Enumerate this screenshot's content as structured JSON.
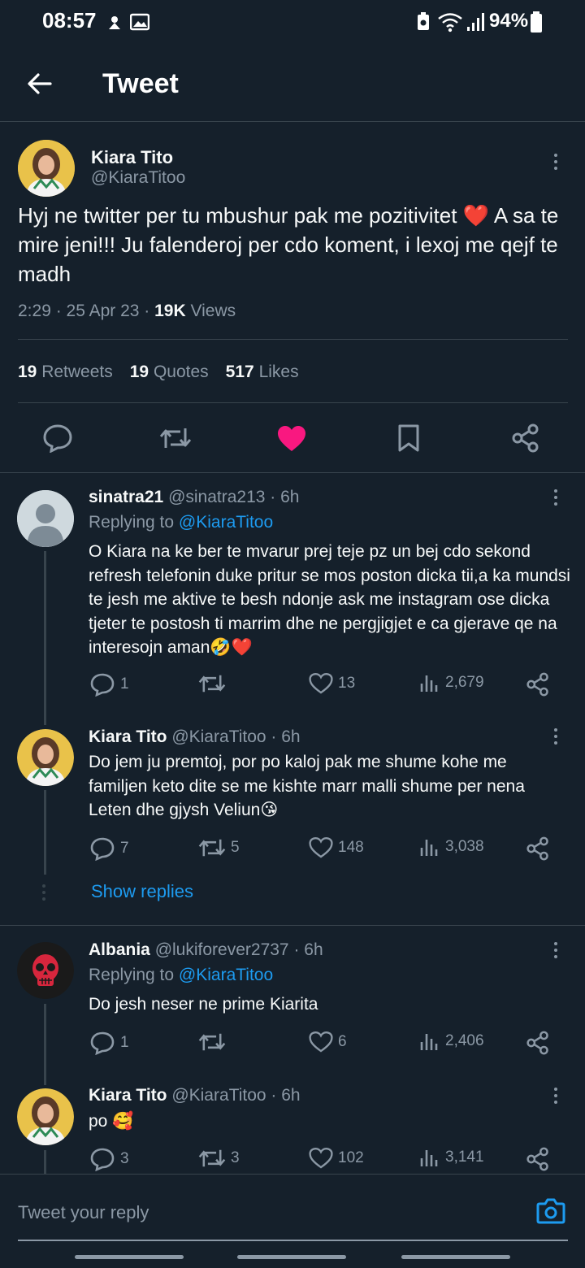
{
  "status_bar": {
    "time": "08:57",
    "battery": "94%"
  },
  "header": {
    "title": "Tweet"
  },
  "tweet": {
    "author_name": "Kiara Tito",
    "author_handle": "@KiaraTitoo",
    "text": "Hyj ne twitter per tu mbushur pak me pozitivitet ❤️ A sa te mire jeni!!! Ju falenderoj per cdo koment, i lexoj me qejf te madh",
    "time": "2:29 · 25 Apr 23 · ",
    "views_count": "19K",
    "views_label": " Views",
    "retweets_count": "19",
    "retweets_label": "Retweets",
    "quotes_count": "19",
    "quotes_label": "Quotes",
    "likes_count": "517",
    "likes_label": "Likes"
  },
  "replies": [
    {
      "name": "sinatra21",
      "handle": "@sinatra213 · 6h",
      "replying_label": "Replying to ",
      "replying_to": "@KiaraTitoo",
      "text": "O Kiara na ke ber te mvarur prej teje pz un bej cdo sekond refresh telefonin duke pritur se mos poston dicka tii,a ka mundsi te jesh me aktive te besh ndonje ask me instagram ose dicka tjeter te postosh ti marrim dhe ne pergjigjet e ca gjerave qe na interesojn aman🤣❤️",
      "comments": "1",
      "retweets": "",
      "likes": "13",
      "views": "2,679"
    },
    {
      "name": "Kiara Tito",
      "handle": "@KiaraTitoo · 6h",
      "text": "Do jem ju premtoj, por po kaloj pak me shume kohe me familjen keto dite se me kishte marr malli shume per nena Leten dhe gjysh Veliun😘",
      "comments": "7",
      "retweets": "5",
      "likes": "148",
      "views": "3,038"
    },
    {
      "name": "Albania",
      "handle": "@lukiforever2737 · 6h",
      "replying_label": "Replying to ",
      "replying_to": "@KiaraTitoo",
      "text": "Do jesh neser ne prime Kiarita",
      "comments": "1",
      "retweets": "",
      "likes": "6",
      "views": "2,406"
    },
    {
      "name": "Kiara Tito",
      "handle": "@KiaraTitoo · 6h",
      "text": "po 🥰",
      "comments": "3",
      "retweets": "3",
      "likes": "102",
      "views": "3,141"
    }
  ],
  "show_replies": "Show replies",
  "composer": {
    "placeholder": "Tweet your reply"
  },
  "colors": {
    "background": "#15202b",
    "accent": "#1d9bf0",
    "like": "#f91880",
    "muted": "#8b98a5",
    "divider": "#38444d"
  }
}
